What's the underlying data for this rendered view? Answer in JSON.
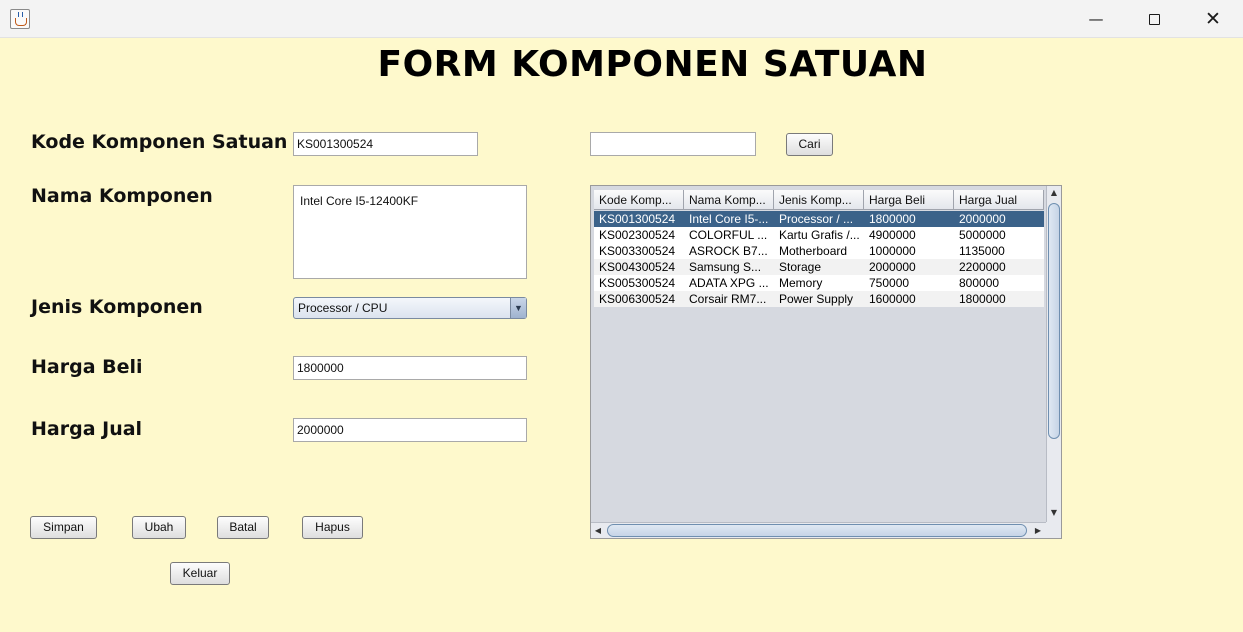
{
  "window": {
    "minimize": "—",
    "close": "✕"
  },
  "title": "FORM KOMPONEN SATUAN",
  "labels": {
    "kode": "Kode Komponen Satuan",
    "nama": "Nama Komponen",
    "jenis": "Jenis Komponen",
    "harga_beli": "Harga Beli",
    "harga_jual": "Harga Jual"
  },
  "fields": {
    "kode": "KS001300524",
    "nama": "Intel Core I5-12400KF",
    "jenis": "Processor / CPU",
    "harga_beli": "1800000",
    "harga_jual": "2000000",
    "search": ""
  },
  "buttons": {
    "cari": "Cari",
    "simpan": "Simpan",
    "ubah": "Ubah",
    "batal": "Batal",
    "hapus": "Hapus",
    "keluar": "Keluar"
  },
  "table": {
    "columns": [
      "Kode Komp...",
      "Nama Komp...",
      "Jenis Komp...",
      "Harga Beli",
      "Harga Jual"
    ],
    "rows": [
      [
        "KS001300524",
        "Intel Core I5-...",
        "Processor / ...",
        "1800000",
        "2000000"
      ],
      [
        "KS002300524",
        "COLORFUL ...",
        "Kartu Grafis /...",
        "4900000",
        "5000000"
      ],
      [
        "KS003300524",
        "ASROCK B7...",
        "Motherboard",
        "1000000",
        "1135000"
      ],
      [
        "KS004300524",
        "Samsung S...",
        "Storage",
        "2000000",
        "2200000"
      ],
      [
        "KS005300524",
        "ADATA XPG ...",
        "Memory",
        "750000",
        "800000"
      ],
      [
        "KS006300524",
        "Corsair RM7...",
        "Power Supply",
        "1600000",
        "1800000"
      ]
    ],
    "selected_row": 0
  },
  "colors": {
    "background": "#fef9cc",
    "selection": "#3b6289"
  }
}
